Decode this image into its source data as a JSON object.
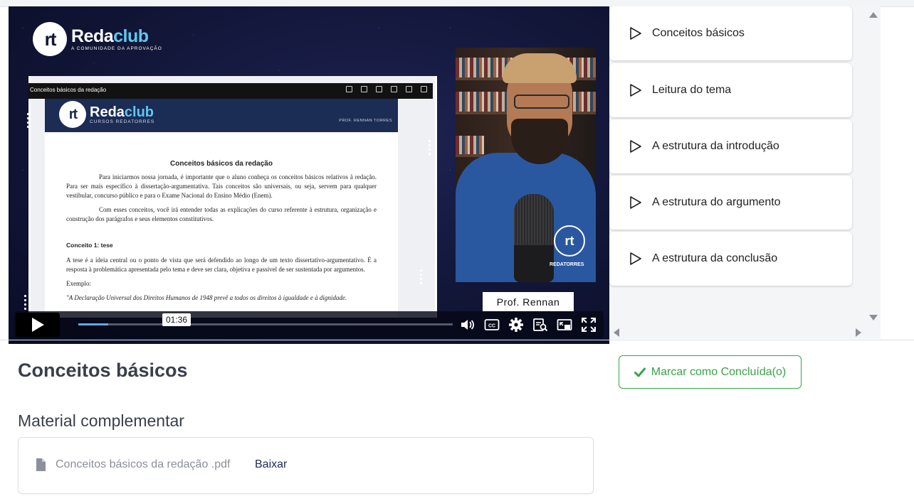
{
  "video": {
    "brand_mark": "rt",
    "brand_name_a": "Reda",
    "brand_name_b": "club",
    "brand_tagline": "A COMUNIDADE DA APROVAÇÃO",
    "doc_window_title": "Conceitos básicos da redação",
    "doc_brand_name_a": "Reda",
    "doc_brand_name_b": "club",
    "doc_brand_sub": "CURSOS REDATORRES",
    "doc_prof": "PROF. RENNAN TORRES",
    "doc_title": "Conceitos básicos da redação",
    "doc_p1": "Para iniciarmos nossa jornada, é importante que o aluno conheça os conceitos básicos relativos à redação. Para ser mais específico à dissertação-argumentativa. Tais conceitos são universais, ou seja, servem para qualquer vestibular, concurso público e para o Exame Nacional do Ensino Médio (Enem).",
    "doc_p2": "Com esses conceitos, você irá entender todas as explicações do curso referente à estrutura, organização e construção dos parágrafos e seus elementos constitutivos.",
    "doc_h1": "Conceito 1: tese",
    "doc_p3": "A tese é a ideia central ou o ponto de vista que será defendido ao longo de um texto dissertativo-argumentativo. É a resposta à problemática apresentada pelo tema e deve ser clara, objetiva e passível de ser sustentada por argumentos.",
    "doc_example": "Exemplo:",
    "doc_quote": "\"A Declaração Universal dos Direitos Humanos de 1948 prevê a todos os direitos à igualdade e à dignidade.",
    "shirt_mark": "rt",
    "shirt_word": "REDATORRES",
    "presenter_name": "Prof. Rennan",
    "time_tooltip": "01:36",
    "progress": 0.08
  },
  "playlist": {
    "items": [
      {
        "label": "Conceitos básicos"
      },
      {
        "label": "Leitura do tema"
      },
      {
        "label": "A estrutura da introdução"
      },
      {
        "label": "A estrutura do argumento"
      },
      {
        "label": "A estrutura da conclusão"
      }
    ]
  },
  "lesson": {
    "title": "Conceitos básicos",
    "complete_label": "Marcar como Concluída(o)",
    "materials_title": "Material complementar",
    "file_name": "Conceitos básicos da redação .pdf",
    "download_label": "Baixar"
  },
  "colors": {
    "accent_green": "#3aa24a",
    "video_bg": "#121638",
    "progress_blue": "#5fa8e6",
    "brand_cyan": "#5ec8f0"
  },
  "icons": [
    "play-icon",
    "volume-icon",
    "captions-icon",
    "settings-icon",
    "transcript-icon",
    "picture-in-picture-icon",
    "fullscreen-icon",
    "check-icon",
    "file-icon"
  ]
}
